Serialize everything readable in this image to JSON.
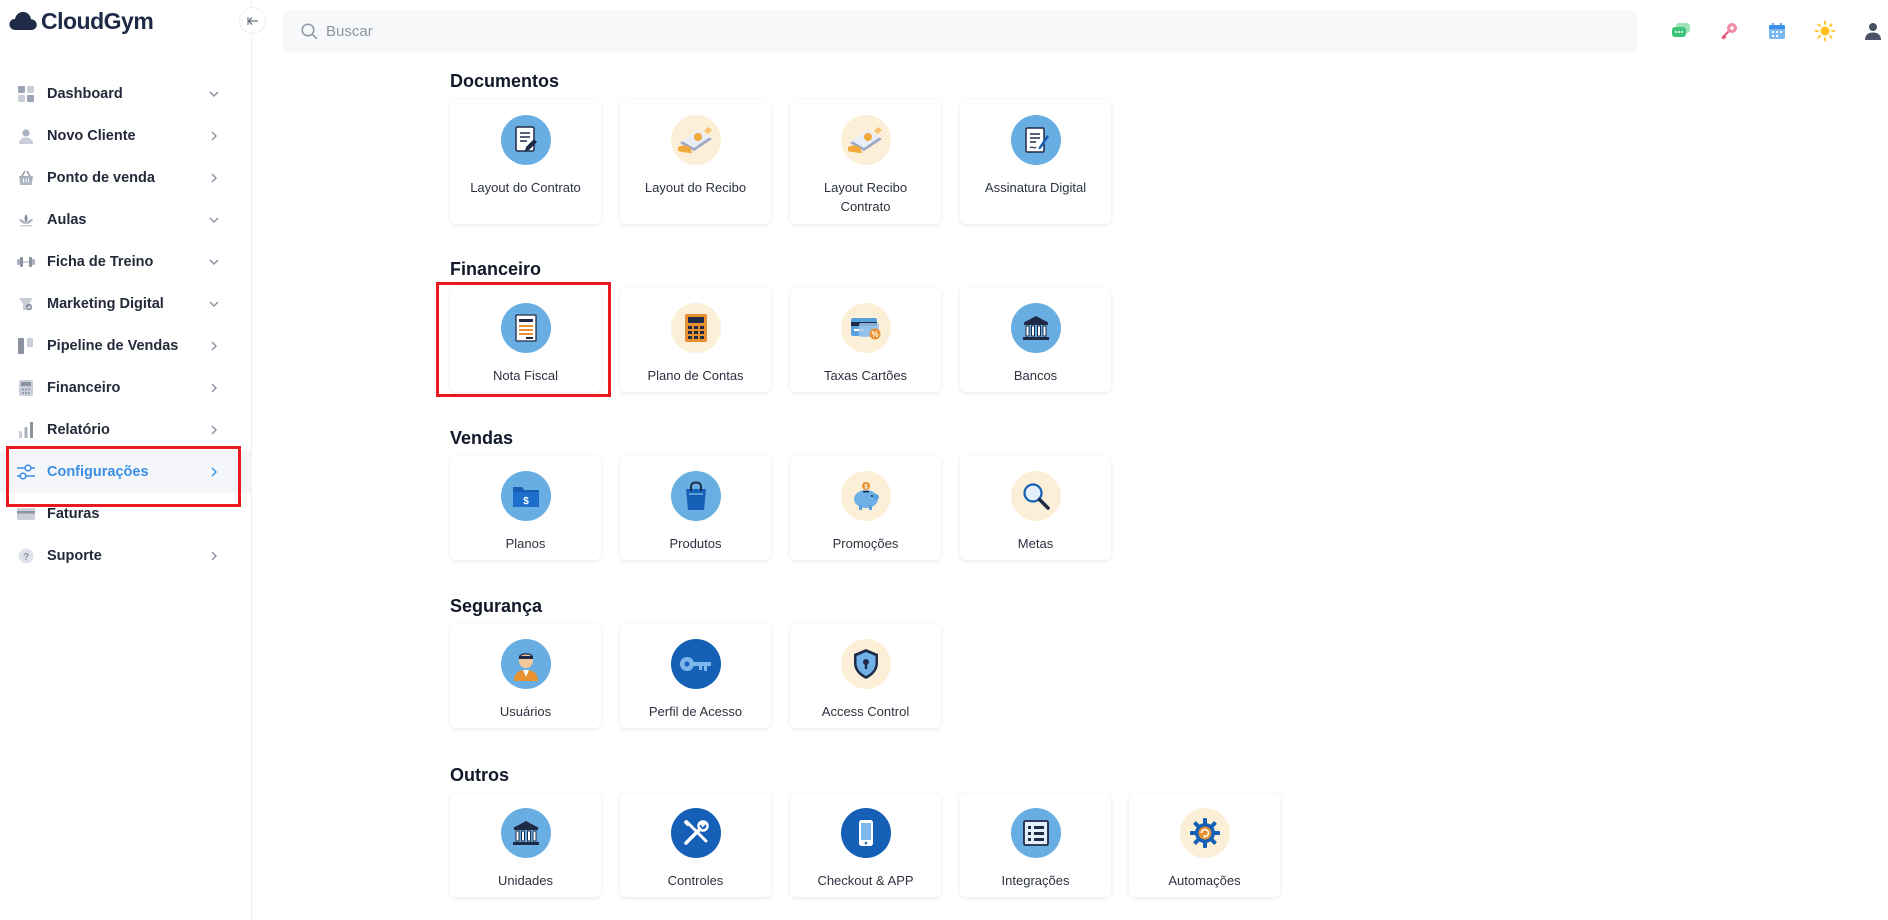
{
  "app": {
    "logo_text": "CloudGym"
  },
  "search": {
    "placeholder": "Buscar"
  },
  "sidebar": {
    "items": [
      {
        "label": "Dashboard",
        "icon": "dashboard-icon",
        "chevron": "down"
      },
      {
        "label": "Novo Cliente",
        "icon": "user-icon",
        "chevron": "right"
      },
      {
        "label": "Ponto de venda",
        "icon": "basket-icon",
        "chevron": "right"
      },
      {
        "label": "Aulas",
        "icon": "lotus-icon",
        "chevron": "down"
      },
      {
        "label": "Ficha de Treino",
        "icon": "dumbbell-icon",
        "chevron": "down"
      },
      {
        "label": "Marketing Digital",
        "icon": "megaphone-icon",
        "chevron": "down"
      },
      {
        "label": "Pipeline de Vendas",
        "icon": "pipeline-icon",
        "chevron": "right"
      },
      {
        "label": "Financeiro",
        "icon": "calculator-icon",
        "chevron": "right"
      },
      {
        "label": "Relatório",
        "icon": "bar-chart-icon",
        "chevron": "right"
      },
      {
        "label": "Configurações",
        "icon": "sliders-icon",
        "chevron": "right",
        "active": true
      },
      {
        "label": "Faturas",
        "icon": "credit-card-icon",
        "chevron": ""
      },
      {
        "label": "Suporte",
        "icon": "help-icon",
        "chevron": "right"
      }
    ]
  },
  "sections": {
    "documentos": {
      "title": "Documentos",
      "cards": [
        {
          "label": "Layout do Contrato",
          "icon": "contract-icon"
        },
        {
          "label": "Layout do Recibo",
          "icon": "receipt-icon"
        },
        {
          "label": "Layout Recibo Contrato",
          "icon": "receipt-contract-icon"
        },
        {
          "label": "Assinatura Digital",
          "icon": "signature-icon"
        }
      ]
    },
    "financeiro": {
      "title": "Financeiro",
      "cards": [
        {
          "label": "Nota Fiscal",
          "icon": "invoice-icon"
        },
        {
          "label": "Plano de Contas",
          "icon": "calculator-icon"
        },
        {
          "label": "Taxas Cartões",
          "icon": "card-fees-icon"
        },
        {
          "label": "Bancos",
          "icon": "bank-icon"
        }
      ]
    },
    "vendas": {
      "title": "Vendas",
      "cards": [
        {
          "label": "Planos",
          "icon": "plans-folder-icon"
        },
        {
          "label": "Produtos",
          "icon": "shopping-bag-icon"
        },
        {
          "label": "Promoções",
          "icon": "piggy-bank-icon"
        },
        {
          "label": "Metas",
          "icon": "magnifier-icon"
        }
      ]
    },
    "seguranca": {
      "title": "Segurança",
      "cards": [
        {
          "label": "Usuários",
          "icon": "user-avatar-icon"
        },
        {
          "label": "Perfil de Acesso",
          "icon": "key-icon"
        },
        {
          "label": "Access Control",
          "icon": "shield-lock-icon"
        }
      ]
    },
    "outros": {
      "title": "Outros",
      "cards": [
        {
          "label": "Unidades",
          "icon": "building-icon"
        },
        {
          "label": "Controles",
          "icon": "tools-icon"
        },
        {
          "label": "Checkout & APP",
          "icon": "smartphone-icon"
        },
        {
          "label": "Integrações",
          "icon": "integrations-icon"
        },
        {
          "label": "Automações",
          "icon": "gear-automation-icon"
        }
      ]
    }
  },
  "colors": {
    "accent": "#3b8ee8",
    "highlight": "#e8191f",
    "icon_blue": "#69aee3",
    "icon_dark_blue": "#1560b6",
    "icon_cream": "#fcefd7"
  }
}
